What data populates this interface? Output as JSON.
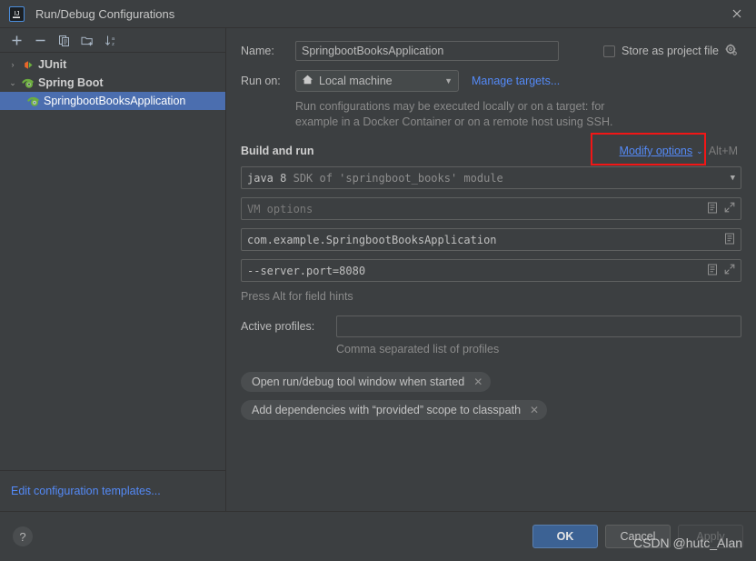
{
  "window": {
    "title": "Run/Debug Configurations",
    "app_icon": "intellij-idea-logo",
    "close_icon": "close-icon"
  },
  "left_panel": {
    "toolbar": [
      {
        "name": "add-configuration-button",
        "icon": "plus-icon",
        "label": "+"
      },
      {
        "name": "remove-configuration-button",
        "icon": "minus-icon",
        "label": "−"
      },
      {
        "name": "copy-configuration-button",
        "icon": "copy-icon",
        "label": ""
      },
      {
        "name": "new-folder-button",
        "icon": "folder-add-icon",
        "label": ""
      },
      {
        "name": "sort-configurations-button",
        "icon": "sort-alpha-icon",
        "label": ""
      }
    ],
    "tree": [
      {
        "label": "JUnit",
        "twisty": "›",
        "icon": "junit-icon",
        "level": 0,
        "bold": true,
        "selected": false
      },
      {
        "label": "Spring Boot",
        "twisty": "⌄",
        "icon": "spring-boot-icon",
        "level": 0,
        "bold": true,
        "selected": false
      },
      {
        "label": "SpringbootBooksApplication",
        "twisty": "",
        "icon": "spring-boot-icon",
        "level": 1,
        "bold": false,
        "selected": true
      }
    ],
    "footer_link": "Edit configuration templates..."
  },
  "form": {
    "name_label": "Name:",
    "name_value": "SpringbootBooksApplication",
    "store_as_project_file_label": "Store as project file",
    "store_as_project_file_checked": false,
    "store_gear_icon": "gear-icon",
    "run_on_label": "Run on:",
    "run_on_value": "Local machine",
    "run_on_icon": "home-icon",
    "manage_targets_link": "Manage targets...",
    "run_on_hint_line1": "Run configurations may be executed locally or on a target: for",
    "run_on_hint_line2": "example in a Docker Container or on a remote host using SSH.",
    "build_and_run_title": "Build and run",
    "modify_options_link": "Modify options",
    "modify_options_shortcut": "Alt+M",
    "sdk_prefix": "java 8",
    "sdk_suffix": "SDK of 'springboot_books' module",
    "vm_options_placeholder": "VM options",
    "vm_options_value": "",
    "main_class_value": "com.example.SpringbootBooksApplication",
    "program_args_value": "--server.port=8080",
    "field_hint": "Press Alt for field hints",
    "active_profiles_label": "Active profiles:",
    "active_profiles_value": "",
    "active_profiles_hint": "Comma separated list of profiles",
    "chips": [
      {
        "label": "Open run/debug tool window when started",
        "close_icon": "chip-close-icon"
      },
      {
        "label": "Add dependencies with “provided” scope to classpath",
        "close_icon": "chip-close-icon"
      }
    ]
  },
  "bottom_bar": {
    "help_label": "?",
    "ok_label": "OK",
    "cancel_label": "Cancel",
    "apply_label": "Apply",
    "apply_enabled": false
  },
  "watermark": "CSDN @hutc_Alan",
  "colors": {
    "background": "#3c3f41",
    "selection_blue": "#4b6eaf",
    "link_blue": "#548af7",
    "primary_button": "#3c6294",
    "highlight_red": "#f21616",
    "spring_green": "#6cad3f",
    "junit_orange": "#e8662a"
  }
}
